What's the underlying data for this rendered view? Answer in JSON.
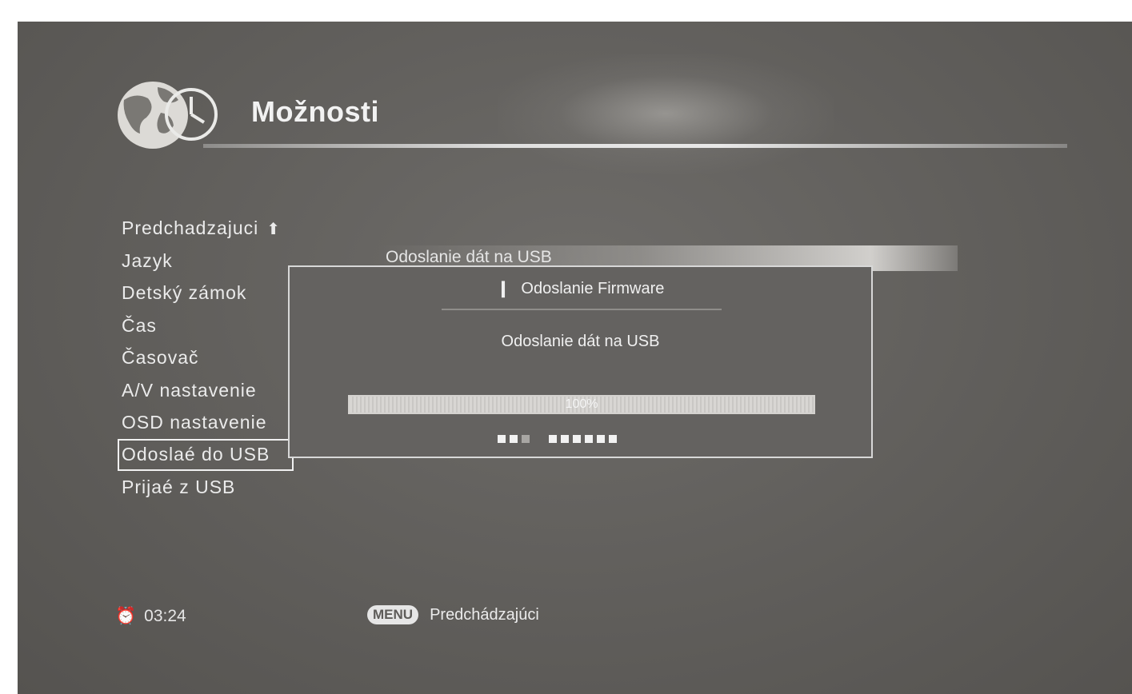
{
  "header": {
    "title": "Možnosti",
    "logo_icon": "globe-clock-icon"
  },
  "menu": {
    "items": [
      {
        "label": "Predchadzajuci",
        "icon": "up-arrow-icon"
      },
      {
        "label": "Jazyk"
      },
      {
        "label": "Detský zámok"
      },
      {
        "label": "Čas"
      },
      {
        "label": "Časovač"
      },
      {
        "label": "A/V nastavenie"
      },
      {
        "label": "OSD nastavenie"
      },
      {
        "label": "Odoslaé do USB",
        "selected": true
      },
      {
        "label": "Prijaé z USB"
      }
    ]
  },
  "behind_panel": {
    "label": "Odoslanie dát na USB"
  },
  "dialog": {
    "title": "Odoslanie Firmware",
    "title_icon": "info-icon",
    "message": "Odoslanie dát na USB",
    "progress_label": "100%",
    "progress_fraction": 1.0
  },
  "footer": {
    "clock_icon": "clock-icon",
    "time": "03:24",
    "menu_key": "MENU",
    "menu_action": "Predchádzajúci"
  },
  "colors": {
    "background": "#605e5b",
    "text": "#ebebeb",
    "dialog_border": "#d8d8d8"
  }
}
